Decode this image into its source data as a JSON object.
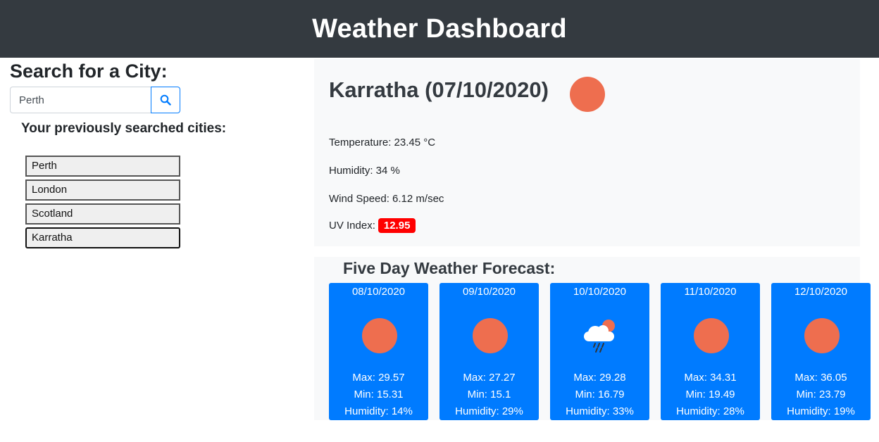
{
  "header": {
    "title": "Weather Dashboard"
  },
  "search": {
    "title": "Search for a City:",
    "value": "Perth",
    "button_icon": "search-icon",
    "history_title": "Your previously searched cities:",
    "history": [
      "Perth",
      "London",
      "Scotland",
      "Karratha"
    ]
  },
  "current": {
    "city_date": "Karratha (07/10/2020)",
    "icon": "clear-sun-icon",
    "temperature": "Temperature: 23.45 °C",
    "humidity": "Humidity: 34 %",
    "wind": "Wind Speed: 6.12 m/sec",
    "uv_label": "UV Index:",
    "uv_value": "12.95",
    "uv_color": "#ff0000"
  },
  "forecast": {
    "title": "Five Day Weather Forecast:",
    "days": [
      {
        "date": "08/10/2020",
        "icon": "clear-sun-icon",
        "max": "Max: 29.57",
        "min": "Min: 15.31",
        "humidity": "Humidity: 14%"
      },
      {
        "date": "09/10/2020",
        "icon": "clear-sun-icon",
        "max": "Max: 27.27",
        "min": "Min: 15.1",
        "humidity": "Humidity: 29%"
      },
      {
        "date": "10/10/2020",
        "icon": "rain-cloud-sun-icon",
        "max": "Max: 29.28",
        "min": "Min: 16.79",
        "humidity": "Humidity: 33%"
      },
      {
        "date": "11/10/2020",
        "icon": "clear-sun-icon",
        "max": "Max: 34.31",
        "min": "Min: 19.49",
        "humidity": "Humidity: 28%"
      },
      {
        "date": "12/10/2020",
        "icon": "clear-sun-icon",
        "max": "Max: 36.05",
        "min": "Min: 23.79",
        "humidity": "Humidity: 19%"
      }
    ]
  },
  "colors": {
    "header_bg": "#343a40",
    "card_bg": "#007bff",
    "sun": "#ee6e4f",
    "panel_bg": "#f8f9fa"
  }
}
